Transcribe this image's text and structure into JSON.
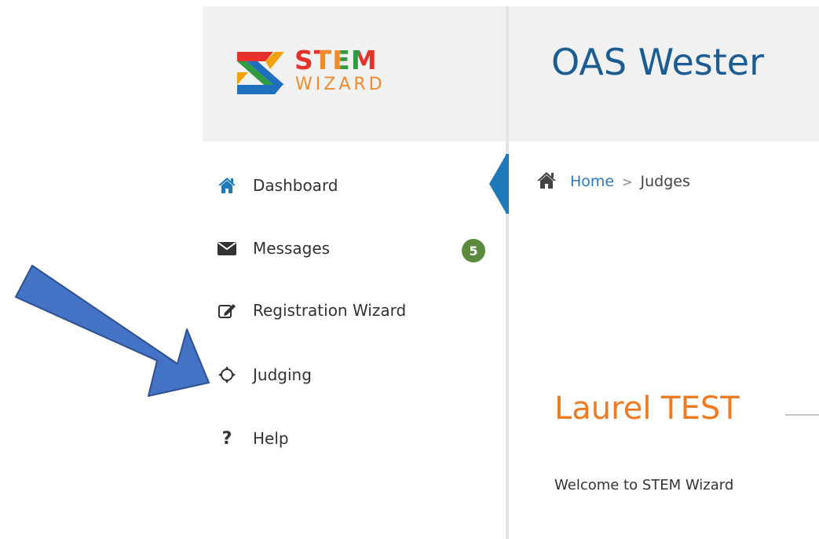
{
  "logo": {
    "stem_text": "STEM",
    "wizard_text": "WIZARD"
  },
  "header": {
    "title": "OAS Wester"
  },
  "sidebar": {
    "items": [
      {
        "label": "Dashboard",
        "icon": "home-icon",
        "active": true
      },
      {
        "label": "Messages",
        "icon": "envelope-icon",
        "badge": "5"
      },
      {
        "label": "Registration Wizard",
        "icon": "edit-icon"
      },
      {
        "label": "Judging",
        "icon": "crosshair-icon"
      },
      {
        "label": "Help",
        "icon": "question-icon"
      }
    ]
  },
  "breadcrumb": {
    "home": "Home",
    "separator": ">",
    "current": "Judges"
  },
  "content": {
    "user_name": "Laurel TEST",
    "welcome": "Welcome to STEM Wizard"
  },
  "colors": {
    "accent": "#1f78b8",
    "title": "#1b5c93",
    "name": "#ee7a22",
    "badge": "#5a8a3c",
    "arrow": "#4472c4"
  }
}
